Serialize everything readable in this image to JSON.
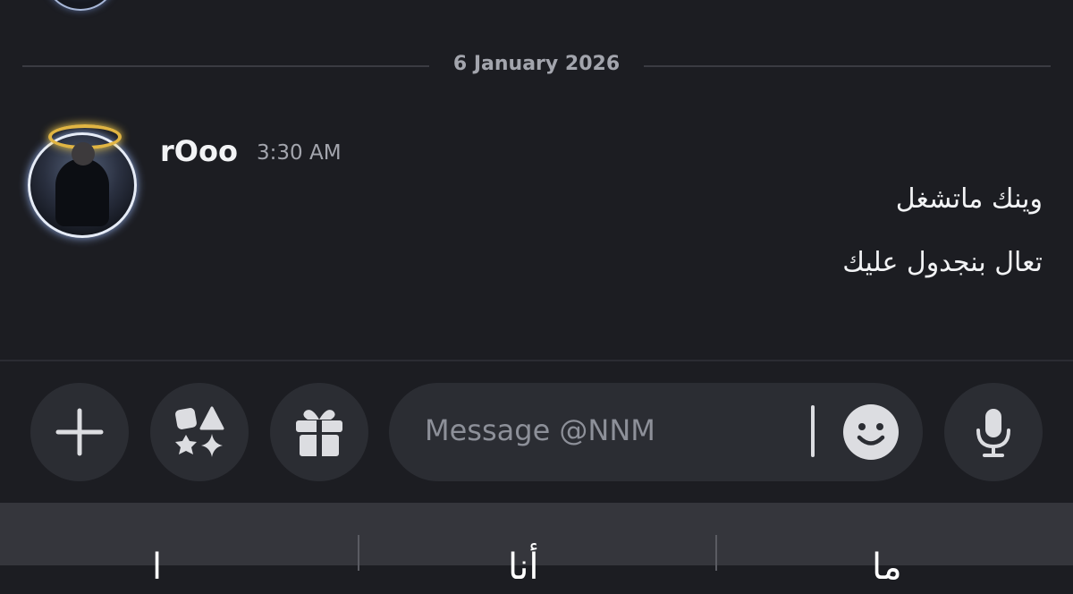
{
  "divider": {
    "date": "6 January 2026"
  },
  "message": {
    "author": "rOoo",
    "time": "3:30 AM",
    "lines": [
      "وينك ماتشغل",
      "تعال بنجدول عليك"
    ]
  },
  "composer": {
    "placeholder": "Message @NNM",
    "buttons": [
      "plus-icon",
      "apps-icon",
      "gift-icon",
      "emoji-icon",
      "microphone-icon"
    ]
  },
  "keyboard_suggestions": [
    "ا",
    "أنا",
    "ما"
  ],
  "colors": {
    "background": "#1c1d22",
    "button": "#2b2d33",
    "text": "#f2f3f5",
    "muted": "#a3a5ad",
    "keyboard_bar": "#35363c"
  }
}
